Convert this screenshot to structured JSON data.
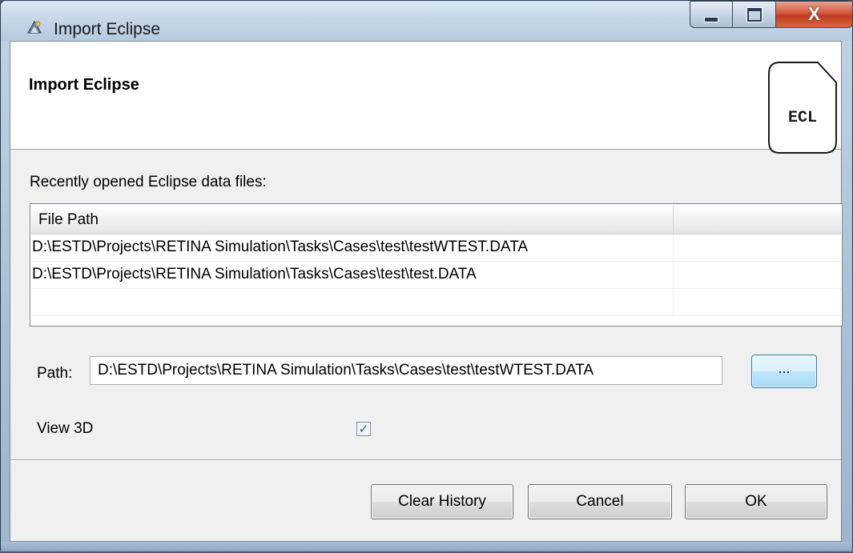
{
  "window": {
    "title": "Import Eclipse",
    "app_icon": "eclipse-app-icon",
    "close_glyph": "X"
  },
  "header": {
    "title": "Import Eclipse",
    "icon_text": "ECL",
    "icon": "ecl-file-icon"
  },
  "recent": {
    "label": "Recently opened Eclipse data files:",
    "columns": [
      "File Path"
    ],
    "rows": [
      "D:\\ESTD\\Projects\\RETINA Simulation\\Tasks\\Cases\\test\\testWTEST.DATA",
      "D:\\ESTD\\Projects\\RETINA Simulation\\Tasks\\Cases\\test\\test.DATA",
      ""
    ]
  },
  "path": {
    "label": "Path:",
    "value": "D:\\ESTD\\Projects\\RETINA Simulation\\Tasks\\Cases\\test\\testWTEST.DATA",
    "browse_label": "..."
  },
  "view3d": {
    "label": "View 3D",
    "checked": true
  },
  "buttons": {
    "clear_history": "Clear History",
    "cancel": "Cancel",
    "ok": "OK"
  }
}
